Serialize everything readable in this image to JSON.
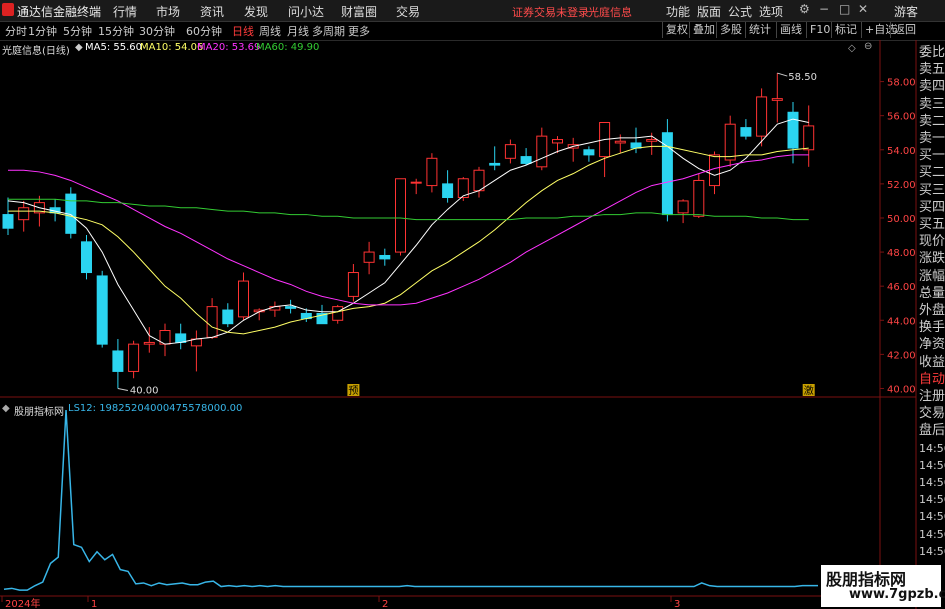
{
  "app": {
    "title": "通达信金融终端",
    "menu": [
      "行情",
      "市场",
      "资讯",
      "发现",
      "问小达",
      "财富圈",
      "交易"
    ],
    "status": "证券交易未登录",
    "stock_name": "光庭信息",
    "right_menu": [
      "功能",
      "版面",
      "公式",
      "选项"
    ],
    "user": "游客"
  },
  "toolbar": {
    "periods": [
      "分时",
      "1分钟",
      "5分钟",
      "15分钟",
      "30分钟",
      "60分钟",
      "日线",
      "周线",
      "月线",
      "多周期",
      "更多"
    ],
    "active_period": "日线",
    "right": [
      "复权",
      "叠加",
      "多股",
      "统计",
      "画线",
      "F10",
      "标记",
      "+自选",
      "返回"
    ]
  },
  "legend": {
    "title": "光庭信息(日线)",
    "ma5": "MA5: 55.60",
    "ma10": "MA10: 54.06",
    "ma20": "MA20: 53.69",
    "ma60": "MA60: 49.90",
    "ma5_color": "#ffffff",
    "ma10_color": "#ffff66",
    "ma20_color": "#ff33ff",
    "ma60_color": "#33cc33"
  },
  "indicator": {
    "title": "股朋指标网",
    "value": "LS12: 19825204000475578000.00",
    "color": "#38b6e8"
  },
  "sidebar": [
    "委比",
    "卖五",
    "卖四",
    "卖三",
    "卖二",
    "卖一",
    "买一",
    "买二",
    "买三",
    "买四",
    "买五",
    "现价",
    "涨跌",
    "涨幅",
    "总量",
    "外盘",
    "换手",
    "净资",
    "收益",
    "自动",
    "注册",
    "交易",
    "盘后",
    "14:56",
    "14:56",
    "14:56",
    "14:56",
    "14:56",
    "14:56",
    "14:56"
  ],
  "watermark": {
    "line1": "股朋指标网",
    "line2": "www.7gpzb.com"
  },
  "chart_data": [
    {
      "type": "candlestick",
      "title": "光庭信息(日线)",
      "ylim": [
        39.5,
        59.5
      ],
      "y_ticks": [
        40.0,
        42.0,
        44.0,
        46.0,
        48.0,
        50.0,
        52.0,
        54.0,
        56.0,
        58.0
      ],
      "annotations": {
        "high": "58.50",
        "low": "40.00",
        "marks": [
          "预",
          "激"
        ]
      },
      "up_color": "#ff3333",
      "down_color": "#2bd4f0",
      "candles": [
        {
          "o": 50.2,
          "h": 51.2,
          "l": 49.0,
          "c": 49.4
        },
        {
          "o": 49.9,
          "h": 51.0,
          "l": 49.2,
          "c": 50.6
        },
        {
          "o": 50.3,
          "h": 51.3,
          "l": 49.5,
          "c": 50.9
        },
        {
          "o": 50.6,
          "h": 51.1,
          "l": 49.8,
          "c": 50.3
        },
        {
          "o": 51.4,
          "h": 51.8,
          "l": 48.8,
          "c": 49.1
        },
        {
          "o": 48.6,
          "h": 49.0,
          "l": 46.4,
          "c": 46.8
        },
        {
          "o": 46.6,
          "h": 46.9,
          "l": 42.4,
          "c": 42.6
        },
        {
          "o": 42.2,
          "h": 42.9,
          "l": 40.0,
          "c": 41.0
        },
        {
          "o": 41.0,
          "h": 42.8,
          "l": 40.6,
          "c": 42.6
        },
        {
          "o": 42.6,
          "h": 43.6,
          "l": 42.1,
          "c": 42.7
        },
        {
          "o": 42.6,
          "h": 43.8,
          "l": 41.9,
          "c": 43.4
        },
        {
          "o": 43.2,
          "h": 43.8,
          "l": 42.3,
          "c": 42.7
        },
        {
          "o": 42.5,
          "h": 43.4,
          "l": 41.0,
          "c": 42.9
        },
        {
          "o": 43.0,
          "h": 45.3,
          "l": 42.9,
          "c": 44.8
        },
        {
          "o": 44.6,
          "h": 45.0,
          "l": 43.6,
          "c": 43.8
        },
        {
          "o": 44.2,
          "h": 46.8,
          "l": 44.0,
          "c": 46.3
        },
        {
          "o": 44.5,
          "h": 44.7,
          "l": 44.0,
          "c": 44.6
        },
        {
          "o": 44.6,
          "h": 45.1,
          "l": 44.2,
          "c": 44.8
        },
        {
          "o": 44.8,
          "h": 45.2,
          "l": 44.4,
          "c": 44.7
        },
        {
          "o": 44.4,
          "h": 44.7,
          "l": 43.9,
          "c": 44.1
        },
        {
          "o": 44.4,
          "h": 44.9,
          "l": 43.9,
          "c": 43.8
        },
        {
          "o": 44.0,
          "h": 44.9,
          "l": 43.8,
          "c": 44.8
        },
        {
          "o": 45.4,
          "h": 47.3,
          "l": 45.1,
          "c": 46.8
        },
        {
          "o": 47.4,
          "h": 48.6,
          "l": 46.7,
          "c": 48.0
        },
        {
          "o": 47.8,
          "h": 48.2,
          "l": 47.2,
          "c": 47.6
        },
        {
          "o": 48.0,
          "h": 52.3,
          "l": 47.8,
          "c": 52.3
        },
        {
          "o": 52.1,
          "h": 52.3,
          "l": 51.4,
          "c": 52.1
        },
        {
          "o": 51.9,
          "h": 53.8,
          "l": 51.5,
          "c": 53.5
        },
        {
          "o": 52.0,
          "h": 52.8,
          "l": 50.9,
          "c": 51.2
        },
        {
          "o": 51.2,
          "h": 52.4,
          "l": 51.0,
          "c": 52.3
        },
        {
          "o": 51.6,
          "h": 53.0,
          "l": 51.2,
          "c": 52.8
        },
        {
          "o": 53.2,
          "h": 54.2,
          "l": 52.8,
          "c": 53.1
        },
        {
          "o": 53.5,
          "h": 54.6,
          "l": 53.2,
          "c": 54.3
        },
        {
          "o": 53.6,
          "h": 54.1,
          "l": 53.1,
          "c": 53.2
        },
        {
          "o": 53.0,
          "h": 55.3,
          "l": 52.8,
          "c": 54.8
        },
        {
          "o": 54.4,
          "h": 54.8,
          "l": 53.8,
          "c": 54.6
        },
        {
          "o": 54.1,
          "h": 54.7,
          "l": 53.3,
          "c": 54.3
        },
        {
          "o": 54.0,
          "h": 54.2,
          "l": 53.3,
          "c": 53.7
        },
        {
          "o": 53.6,
          "h": 55.6,
          "l": 52.4,
          "c": 55.6
        },
        {
          "o": 54.4,
          "h": 54.9,
          "l": 53.8,
          "c": 54.5
        },
        {
          "o": 54.4,
          "h": 55.3,
          "l": 53.8,
          "c": 54.1
        },
        {
          "o": 54.5,
          "h": 55.0,
          "l": 53.7,
          "c": 54.6
        },
        {
          "o": 55.0,
          "h": 55.8,
          "l": 49.8,
          "c": 50.2
        },
        {
          "o": 50.3,
          "h": 51.1,
          "l": 49.7,
          "c": 51.0
        },
        {
          "o": 50.1,
          "h": 52.6,
          "l": 50.0,
          "c": 52.2
        },
        {
          "o": 51.9,
          "h": 53.9,
          "l": 51.4,
          "c": 53.7
        },
        {
          "o": 53.4,
          "h": 56.0,
          "l": 53.0,
          "c": 55.5
        },
        {
          "o": 55.3,
          "h": 55.8,
          "l": 54.6,
          "c": 54.8
        },
        {
          "o": 54.8,
          "h": 57.6,
          "l": 54.2,
          "c": 57.1
        },
        {
          "o": 56.9,
          "h": 58.5,
          "l": 55.6,
          "c": 57.0
        },
        {
          "o": 56.2,
          "h": 56.8,
          "l": 53.2,
          "c": 54.1
        },
        {
          "o": 54.0,
          "h": 56.6,
          "l": 53.0,
          "c": 55.4
        }
      ],
      "ma_series": [
        {
          "name": "MA5",
          "values": [
            51.0,
            50.9,
            50.6,
            50.4,
            50.2,
            49.4,
            48.0,
            46.1,
            44.6,
            43.1,
            42.6,
            42.7,
            42.9,
            43.0,
            43.3,
            44.0,
            44.5,
            44.8,
            44.9,
            44.6,
            44.5,
            44.5,
            45.0,
            45.6,
            46.2,
            47.3,
            48.4,
            49.6,
            50.5,
            51.3,
            51.6,
            52.2,
            52.8,
            53.1,
            53.5,
            53.9,
            54.2,
            54.4,
            54.6,
            54.7,
            54.7,
            54.8,
            54.2,
            53.5,
            52.9,
            52.5,
            52.8,
            53.5,
            54.5,
            55.5,
            55.8,
            55.6
          ]
        },
        {
          "name": "MA10",
          "values": [
            50.4,
            50.4,
            50.4,
            50.3,
            50.1,
            49.9,
            49.6,
            48.9,
            48.0,
            47.0,
            46.0,
            45.3,
            44.4,
            43.6,
            43.3,
            43.2,
            43.4,
            43.6,
            43.9,
            44.1,
            44.3,
            44.5,
            44.7,
            44.8,
            45.0,
            45.5,
            46.2,
            46.9,
            47.4,
            48.0,
            48.6,
            49.3,
            50.1,
            50.9,
            51.6,
            52.2,
            52.6,
            53.1,
            53.5,
            53.8,
            54.1,
            54.2,
            54.2,
            54.0,
            53.8,
            53.6,
            53.6,
            53.7,
            53.7,
            53.9,
            54.0,
            54.1
          ]
        },
        {
          "name": "MA20",
          "values": [
            52.8,
            52.8,
            52.7,
            52.5,
            52.2,
            51.8,
            51.4,
            51.0,
            50.5,
            50.0,
            49.5,
            49.1,
            48.6,
            48.1,
            47.6,
            47.2,
            46.8,
            46.4,
            46.1,
            45.7,
            45.4,
            45.2,
            45.0,
            44.9,
            44.9,
            44.9,
            45.0,
            45.3,
            45.6,
            46.0,
            46.4,
            46.9,
            47.4,
            48.0,
            48.5,
            49.0,
            49.5,
            50.0,
            50.5,
            51.0,
            51.5,
            51.9,
            52.1,
            52.3,
            52.6,
            52.9,
            53.1,
            53.3,
            53.4,
            53.6,
            53.7,
            53.7
          ]
        },
        {
          "name": "MA60",
          "values": [
            51.1,
            51.1,
            51.1,
            51.1,
            51.0,
            51.0,
            50.9,
            50.9,
            50.8,
            50.7,
            50.7,
            50.6,
            50.6,
            50.5,
            50.4,
            50.4,
            50.3,
            50.3,
            50.2,
            50.2,
            50.1,
            50.1,
            50.0,
            50.0,
            50.0,
            50.0,
            49.9,
            49.9,
            49.9,
            49.9,
            49.9,
            49.9,
            49.9,
            50.0,
            50.0,
            50.0,
            50.1,
            50.1,
            50.2,
            50.2,
            50.3,
            50.3,
            50.2,
            50.2,
            50.2,
            50.1,
            50.1,
            50.1,
            50.0,
            50.0,
            49.9,
            49.9
          ]
        }
      ]
    },
    {
      "type": "line",
      "title": "股朋指标网",
      "series_name": "LS12",
      "x_labels": [
        "2024年",
        "1",
        "2",
        "3"
      ],
      "values": [
        0.2,
        0.3,
        0.1,
        0.1,
        0.6,
        1.0,
        3.1,
        3.8,
        20.3,
        5.2,
        4.9,
        3.3,
        4.4,
        3.5,
        4.1,
        2.4,
        2.2,
        0.8,
        0.9,
        0.6,
        0.9,
        0.7,
        0.8,
        0.9,
        0.7,
        0.7,
        1.0,
        1.1,
        0.5,
        0.6,
        0.5,
        0.6,
        0.5,
        0.6,
        0.5,
        0.6,
        0.5,
        0.5,
        0.5,
        0.5,
        0.5,
        0.5,
        0.5,
        0.5,
        0.5,
        0.5,
        0.5,
        0.5,
        0.5,
        0.5,
        0.5,
        0.5,
        0.6,
        0.5,
        0.5,
        0.5,
        0.5,
        0.5,
        0.5,
        0.5,
        0.5,
        0.5,
        0.5,
        0.5,
        0.5,
        0.5,
        0.5,
        0.5,
        0.5,
        0.5,
        0.5,
        0.5,
        0.5,
        0.5,
        0.5,
        0.5,
        0.5,
        0.5,
        0.5,
        0.5,
        0.5,
        0.5,
        0.5,
        0.5,
        0.5,
        0.5,
        0.5,
        0.5,
        0.5,
        0.5,
        0.9,
        0.6,
        0.5,
        0.5,
        0.5,
        0.5,
        0.5,
        0.5,
        0.5,
        0.5,
        0.5,
        0.5,
        0.5,
        0.6,
        0.6,
        0.6
      ]
    }
  ]
}
